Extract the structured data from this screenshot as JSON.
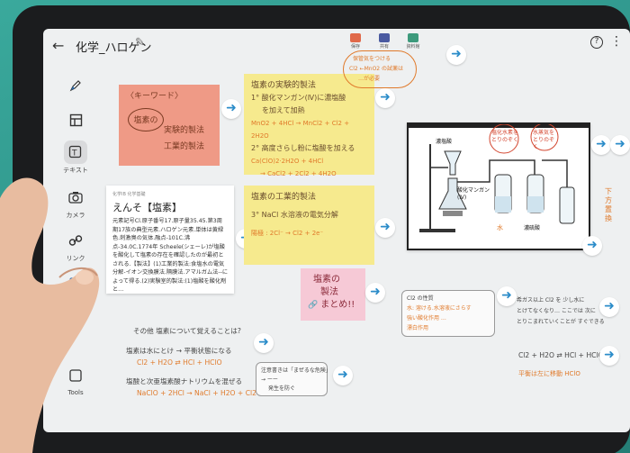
{
  "header": {
    "title": "化学_ハロゲン",
    "tools": [
      {
        "label": "保存",
        "color": "#e0694a"
      },
      {
        "label": "共有",
        "color": "#4a5aa0"
      },
      {
        "label": "資料館",
        "color": "#3d9a7c"
      }
    ],
    "help": "?"
  },
  "toolbar": [
    {
      "label": ""
    },
    {
      "label": ""
    },
    {
      "label": "テキスト"
    },
    {
      "label": "カメラ"
    },
    {
      "label": "リンク"
    },
    {
      "label": "ファ"
    },
    {
      "label": "Tools"
    }
  ],
  "notes": {
    "keyword": {
      "tag": "〈キーワード〉",
      "circle": "塩素の",
      "lines": [
        "実験的製法",
        "工業的製法"
      ]
    },
    "experiment": {
      "title": "塩素の実験的製法",
      "lines": [
        "1° 酸化マンガン(Ⅳ)に濃塩酸",
        "を加えて加熱",
        "MnO2 + 4HCl → MnCl2 + Cl2 + 2H2O",
        "2° 高度さらし粉に塩酸を加える",
        "Ca(ClO)2·2H2O + 4HCl",
        "→ CaCl2 + 2Cl2 + 4H2O"
      ]
    },
    "industrial": {
      "title": "塩素の工業的製法",
      "lines": [
        "3° NaCl 水溶液の電気分解",
        "陽極 : 2Cl⁻ → Cl2 + 2e⁻"
      ]
    },
    "summary": {
      "lines": [
        "塩素の",
        "製法",
        "まとめ!!"
      ]
    },
    "callout": {
      "lines": [
        "保管気をつける",
        "Cl2 ←MnO2 の試薬は",
        "…が必要"
      ]
    },
    "side": "下方置換"
  },
  "document": {
    "meta": "化学IB 化学基礎",
    "title": "えんそ【塩素】",
    "body": "元素記号Cl.原子番号17.原子量35.45.第3周期17族の典型元素.ハロゲン元素.単体は黄緑色.刺激臭の気体.融点-101C.沸点-34.0C.1774年 Scheele(シェーレ)が塩酸を酸化して塩素の存在を確認したのが最初とされる.【製法】(1)工業的製法:食塩水の電気分解-イオン交換膜法.隔膜法.アマルガム法--によって得る.(2)実験室的製法:(1)塩酸を酸化剤と…"
  },
  "diagram": {
    "labels": [
      "濃塩酸",
      "酸化マンガン(Ⅳ)",
      "塩化水素をとりのぞく",
      "水蒸気をとりのぞく",
      "水",
      "濃硫酸"
    ]
  },
  "bottom": {
    "question": "その他 塩素について覚えることは?",
    "items": [
      "塩素は水にとけ → 平衡状態になる",
      "Cl2 + H2O ⇄ HCl + HClO",
      "塩酸と次亜塩素酸ナトリウムを混ぜる",
      "NaClO + 2HCl → NaCl + H2O + Cl2"
    ],
    "warn": [
      "注意書きは「まぜるな危険」",
      "→ ーー",
      "発生を防ぐ"
    ],
    "box": [
      "Cl2 の性質",
      "水: 溶ける.水溶液にさらす",
      "強い酸化作用 …",
      "漂白作用"
    ],
    "right": [
      "希ガス以上 Cl2 を 少し水に",
      "とけてなくなり… ここでは 次に",
      "とりこまれていくことが すぐできる"
    ],
    "equation": [
      "Cl2 + H2O ⇄ HCl + HClO",
      "平衡は左に移動 HClO"
    ]
  }
}
